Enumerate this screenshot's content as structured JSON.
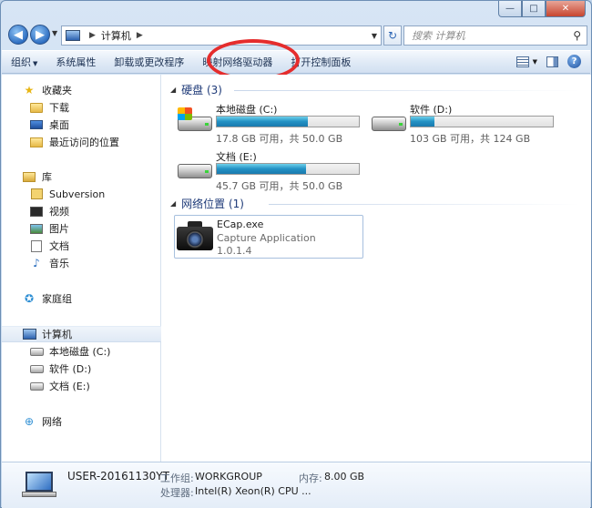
{
  "window": {
    "caption": {
      "minimize": "—",
      "maximize": "□",
      "close": "✕"
    }
  },
  "address_bar": {
    "path": [
      "计算机"
    ],
    "search_placeholder": "搜索 计算机"
  },
  "toolbar": {
    "organize": "组织",
    "system_properties": "系统属性",
    "uninstall": "卸载或更改程序",
    "map_drive": "映射网络驱动器",
    "control_panel": "打开控制面板"
  },
  "nav": {
    "favorites": "收藏夹",
    "downloads": "下载",
    "desktop": "桌面",
    "recent": "最近访问的位置",
    "libraries": "库",
    "subversion": "Subversion",
    "videos": "视频",
    "pictures": "图片",
    "documents": "文档",
    "music": "音乐",
    "homegroup": "家庭组",
    "computer": "计算机",
    "drive_c": "本地磁盘 (C:)",
    "drive_d": "软件 (D:)",
    "drive_e": "文档 (E:)",
    "network": "网络"
  },
  "content": {
    "hard_drives_title": "硬盘 (3)",
    "network_title": "网络位置 (1)",
    "drives": [
      {
        "name": "本地磁盘 (C:)",
        "free": "17.8 GB 可用，共 50.0 GB",
        "used_fraction": 0.644
      },
      {
        "name": "软件 (D:)",
        "free": "103 GB 可用，共 124 GB",
        "used_fraction": 0.169
      },
      {
        "name": "文档 (E:)",
        "free": "45.7 GB 可用，共 50.0 GB",
        "used_fraction": 0.63
      }
    ],
    "network_location": {
      "name": "ECap.exe",
      "description": "Capture Application",
      "version": "1.0.1.4"
    }
  },
  "details": {
    "computer_name": "USER-20161130YT",
    "workgroup_label": "工作组:",
    "workgroup_value": "WORKGROUP",
    "memory_label": "内存:",
    "memory_value": "8.00 GB",
    "processor_label": "处理器:",
    "processor_value": "Intel(R) Xeon(R) CPU ..."
  },
  "colors": {
    "highlight_ring": "#e52d2d",
    "group_title": "#1e3a78",
    "bar_fill": "#2391c4"
  }
}
